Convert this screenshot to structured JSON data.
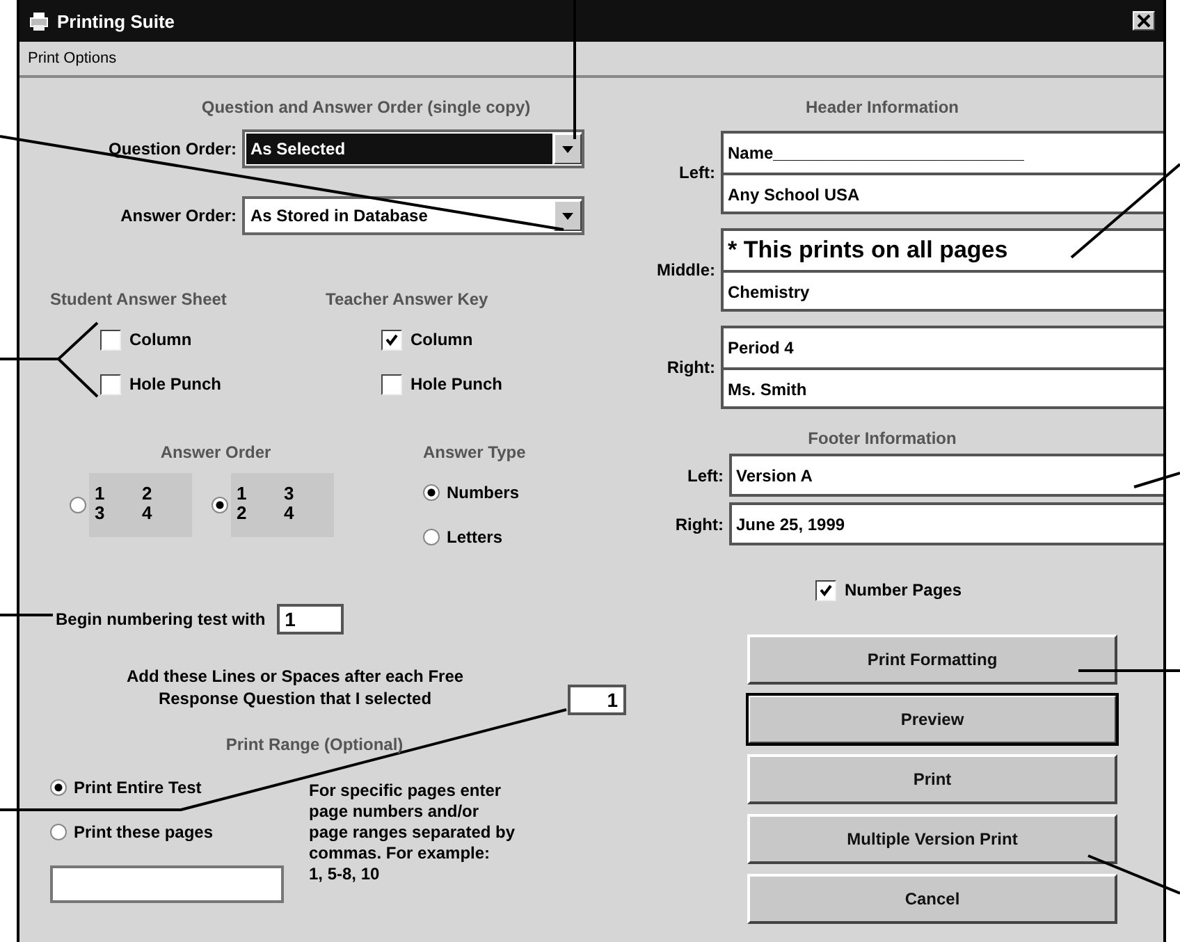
{
  "window": {
    "title": "Printing Suite"
  },
  "menu": [
    {
      "label": "Print Options"
    }
  ],
  "order": {
    "heading": "Question and  Answer Order (single copy)",
    "fields": [
      {
        "label": "Question Order:",
        "value": "As Selected",
        "selected": true
      },
      {
        "label": "Answer Order:",
        "value": "As Stored in Database",
        "selected": false
      }
    ]
  },
  "answer_sheets": [
    {
      "heading": "Student Answer Sheet",
      "options": [
        {
          "label": "Column",
          "checked": false
        },
        {
          "label": "Hole Punch",
          "checked": false
        }
      ]
    },
    {
      "heading": "Teacher Answer Key",
      "options": [
        {
          "label": "Column",
          "checked": true
        },
        {
          "label": "Hole Punch",
          "checked": false
        }
      ]
    }
  ],
  "answer_order": {
    "heading": "Answer Order",
    "options": [
      {
        "cells": [
          "1",
          "2",
          "3",
          "4"
        ],
        "selected": false
      },
      {
        "cells": [
          "1",
          "3",
          "2",
          "4"
        ],
        "selected": true
      }
    ]
  },
  "answer_type": {
    "heading": "Answer Type",
    "options": [
      {
        "label": "Numbers",
        "selected": true
      },
      {
        "label": "Letters",
        "selected": false
      }
    ]
  },
  "begin_numbering": {
    "label": "Begin numbering test with",
    "value": "1"
  },
  "spacing": {
    "label": "Add these Lines or Spaces after each Free\nResponse Question that I selected",
    "value": "1"
  },
  "print_range": {
    "heading": "Print Range (Optional)",
    "options": [
      {
        "label": "Print Entire Test",
        "selected": true
      },
      {
        "label": "Print these pages",
        "selected": false
      }
    ],
    "help": "For specific pages enter\npage numbers and/or\npage ranges separated by\ncommas. For example:\n1, 5-8, 10"
  },
  "header": {
    "heading": "Header Information",
    "groups": [
      {
        "label": "Left:",
        "lines": [
          {
            "value": "Name___________________________",
            "kind": "plain"
          },
          {
            "value": "Any School USA",
            "kind": "plain"
          }
        ]
      },
      {
        "label": "Middle:",
        "lines": [
          {
            "value": "* This prints on all pages",
            "kind": "annotation"
          },
          {
            "value": "Chemistry",
            "kind": "plain"
          }
        ]
      },
      {
        "label": "Right:",
        "lines": [
          {
            "value": "Period 4",
            "kind": "plain"
          },
          {
            "value": "Ms. Smith",
            "kind": "plain"
          }
        ]
      }
    ]
  },
  "footer": {
    "heading": "Footer Information",
    "fields": [
      {
        "label": "Left:",
        "value": "Version A"
      },
      {
        "label": "Right:",
        "value": "June 25, 1999"
      }
    ]
  },
  "number_pages": {
    "label": "Number Pages",
    "checked": true
  },
  "buttons": [
    {
      "label": "Print Formatting",
      "default": false
    },
    {
      "label": "Preview",
      "default": true
    },
    {
      "label": "Print",
      "default": false
    },
    {
      "label": "Multiple Version Print",
      "default": false
    },
    {
      "label": "Cancel",
      "default": false
    }
  ]
}
